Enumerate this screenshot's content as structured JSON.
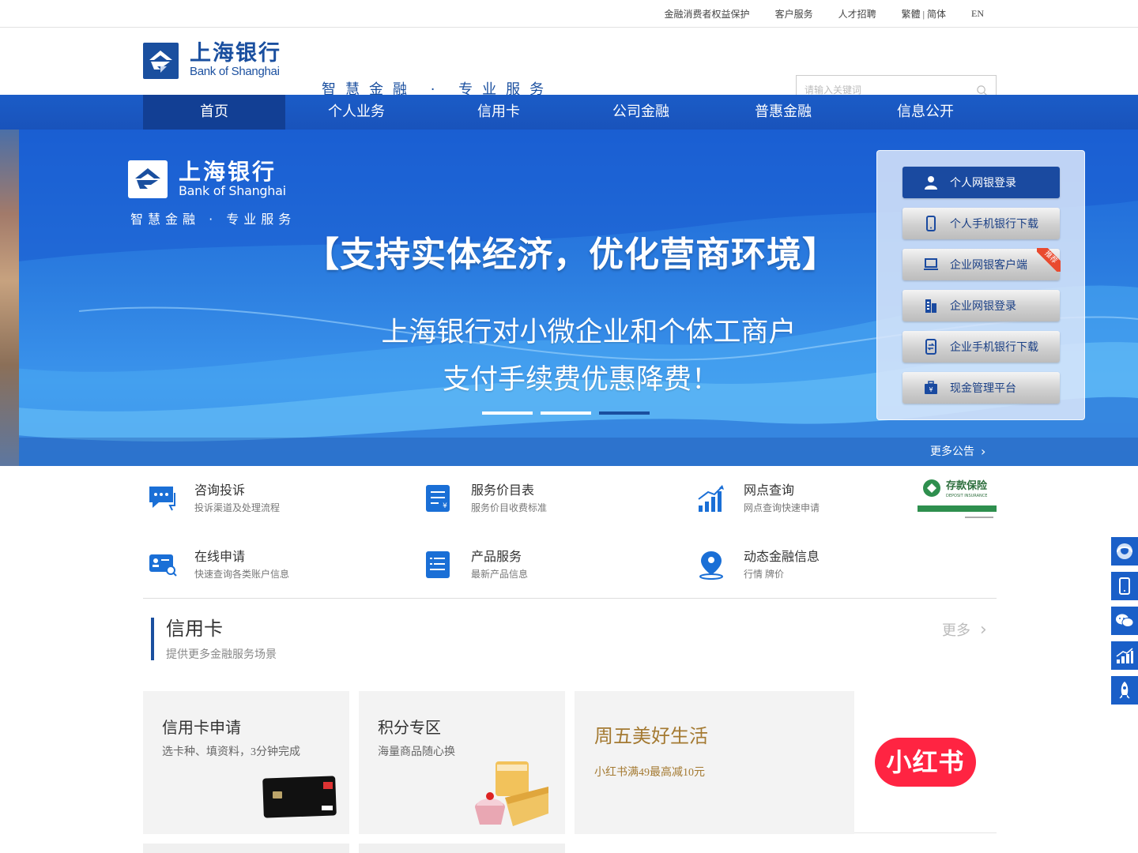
{
  "topbar": {
    "links": [
      "金融消费者权益保护",
      "客户服务",
      "人才招聘",
      "繁體 | 简体",
      "EN"
    ]
  },
  "header": {
    "logo_cn": "上海银行",
    "logo_en": "Bank of Shanghai",
    "slogan": "智慧金融 · 专业服务",
    "search_placeholder": "请输入关键词"
  },
  "nav": {
    "items": [
      "首页",
      "个人业务",
      "信用卡",
      "公司金融",
      "普惠金融",
      "信息公开"
    ],
    "active_index": 0
  },
  "banner": {
    "logo_cn": "上海银行",
    "logo_en": "Bank of Shanghai",
    "slogan": "智慧金融 · 专业服务",
    "headline": "【支持实体经济，优化营商环境】",
    "line1": "上海银行对小微企业和个体工商户",
    "line2": "支付手续费优惠降费！",
    "slides": 3,
    "active_slide": 3,
    "more_notice": "更多公告"
  },
  "login_panel": {
    "buttons": [
      {
        "label": "个人网银登录",
        "icon": "user-icon"
      },
      {
        "label": "个人手机银行下载",
        "icon": "mobile-icon"
      },
      {
        "label": "企业网银客户端",
        "icon": "computer-icon",
        "badge": "推荐"
      },
      {
        "label": "企业网银登录",
        "icon": "building-icon"
      },
      {
        "label": "企业手机银行下载",
        "icon": "mobile-exchange-icon"
      },
      {
        "label": "现金管理平台",
        "icon": "cash-briefcase-icon"
      }
    ]
  },
  "services": [
    {
      "title": "咨询投诉",
      "sub": "投诉渠道及处理流程",
      "icon": "chat-bubble-icon"
    },
    {
      "title": "服务价目表",
      "sub": "服务价目收费标准",
      "icon": "price-list-icon"
    },
    {
      "title": "网点查询",
      "sub": "网点查询快速申请",
      "icon": "bar-chart-icon"
    },
    {
      "title": "在线申请",
      "sub": "快速查询各类账户信息",
      "icon": "id-card-search-icon"
    },
    {
      "title": "产品服务",
      "sub": "最新产品信息",
      "icon": "product-list-icon"
    },
    {
      "title": "动态金融信息",
      "sub": "行情 牌价",
      "icon": "location-pin-icon"
    }
  ],
  "deposit_insurance": {
    "cn": "存款保险",
    "en": "DEPOSIT INSURANCE"
  },
  "credit_section": {
    "title": "信用卡",
    "sub": "提供更多金融服务场景",
    "more": "更多",
    "cards": [
      {
        "title": "信用卡申请",
        "sub": "选卡种、填资料，3分钟完成"
      },
      {
        "title": "积分专区",
        "sub": "海量商品随心换"
      },
      {
        "title": "周五美好生活",
        "sub": "小红书满49最高减10元"
      }
    ],
    "promo_brand": "小红书"
  },
  "colors": {
    "brand": "#1a4f9f",
    "nav": "#1b5cc7",
    "nav_active": "#123f94",
    "promo": "#a47a32",
    "xhs": "#ff2442"
  }
}
